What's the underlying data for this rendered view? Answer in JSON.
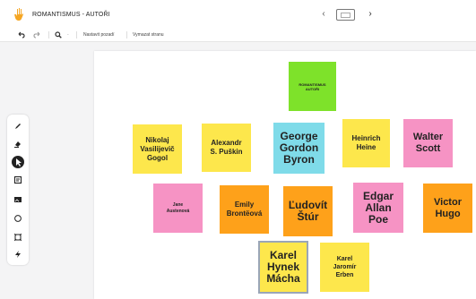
{
  "window": {
    "title": "ROMANTISMUS - AUTOŘI",
    "logo_icon": "hand-wave-icon"
  },
  "navigation": {
    "prev_icon": "chevron-left-icon",
    "page_icon": "page-thumbnail-icon",
    "next_icon": "chevron-right-icon"
  },
  "toolbar": {
    "undo_icon": "undo-icon",
    "redo_icon": "redo-icon",
    "zoom_icon": "zoom-icon",
    "zoom_out": "-",
    "set_zoom_label": "Nastavit pozadí",
    "clear_page_label": "Vymazat stranu"
  },
  "tools": [
    {
      "name": "pen-tool",
      "icon": "pen-icon"
    },
    {
      "name": "marker-tool",
      "icon": "marker-icon"
    },
    {
      "name": "select-tool",
      "icon": "cursor-icon",
      "active": true
    },
    {
      "name": "note-tool",
      "icon": "sticky-note-icon"
    },
    {
      "name": "image-tool",
      "icon": "image-icon"
    },
    {
      "name": "shape-tool",
      "icon": "circle-icon"
    },
    {
      "name": "frame-tool",
      "icon": "frame-icon"
    },
    {
      "name": "extra-tool",
      "icon": "lightning-icon"
    }
  ],
  "colors": {
    "green": "#7ee22a",
    "yellow": "#fde74c",
    "cyan": "#7fdbe9",
    "pink": "#f693c4",
    "orange": "#fea11a"
  },
  "notes": [
    {
      "id": "romantismus",
      "text": "ROMANTISMUS\nAUTOŘI",
      "color": "#7ee22a"
    },
    {
      "id": "gogol",
      "text": "Nikolaj\nVasilijevič\nGogol",
      "color": "#fde74c"
    },
    {
      "id": "puskin",
      "text": "Alexandr\nS. Puškin",
      "color": "#fde74c"
    },
    {
      "id": "byron",
      "text": "George\nGordon\nByron",
      "color": "#7fdbe9"
    },
    {
      "id": "heine",
      "text": "Heinrich\nHeine",
      "color": "#fde74c"
    },
    {
      "id": "scott",
      "text": "Walter\nScott",
      "color": "#f693c4"
    },
    {
      "id": "austen",
      "text": "Jane\nAustenová",
      "color": "#f693c4"
    },
    {
      "id": "bronte",
      "text": "Emily\nBrontëová",
      "color": "#fea11a"
    },
    {
      "id": "stur",
      "text": "Ľudovít\nŠtúr",
      "color": "#fea11a"
    },
    {
      "id": "poe",
      "text": "Edgar\nAllan\nPoe",
      "color": "#f693c4"
    },
    {
      "id": "hugo",
      "text": "Victor\nHugo",
      "color": "#fea11a"
    },
    {
      "id": "macha",
      "text": "Karel\nHynek\nMácha",
      "color": "#fde74c"
    },
    {
      "id": "erben",
      "text": "Karel\nJaromír\nErben",
      "color": "#fde74c"
    }
  ]
}
